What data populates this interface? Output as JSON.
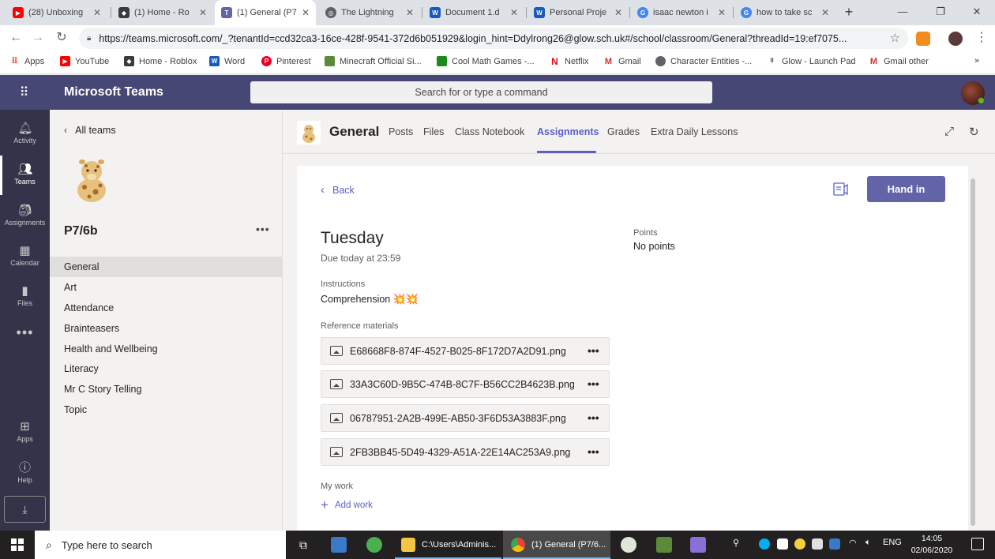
{
  "browser": {
    "tabs": [
      {
        "label": "(28) Unboxing",
        "icon": "youtube-icon",
        "color": "#ff0000"
      },
      {
        "label": "(1) Home - Ro",
        "icon": "roblox-icon",
        "color": "#393b3d"
      },
      {
        "label": "(1) General (P7",
        "icon": "teams-icon",
        "color": "#6264a7"
      },
      {
        "label": "The Lightning",
        "icon": "web-icon",
        "color": "#5f6368"
      },
      {
        "label": "Document 1.d",
        "icon": "word-icon",
        "color": "#185abd"
      },
      {
        "label": "Personal Proje",
        "icon": "word-icon",
        "color": "#185abd"
      },
      {
        "label": "isaac newton i",
        "icon": "google-icon",
        "color": "#4285f4"
      },
      {
        "label": "how to take sc",
        "icon": "google-icon",
        "color": "#4285f4"
      }
    ],
    "url": "https://teams.microsoft.com/_?tenantId=ccd32ca3-16ce-428f-9541-372d6b051929&login_hint=Ddylrong26@glow.sch.uk#/school/classroom/General?threadId=19:ef7075...",
    "bookmarks": [
      {
        "label": "Apps",
        "color": "#ea4335"
      },
      {
        "label": "YouTube",
        "color": "#ff0000"
      },
      {
        "label": "Home - Roblox",
        "color": "#393b3d"
      },
      {
        "label": "Word",
        "color": "#185abd"
      },
      {
        "label": "Pinterest",
        "color": "#e60023"
      },
      {
        "label": "Minecraft Official Si...",
        "color": "#5d8a3a"
      },
      {
        "label": "Cool Math Games -...",
        "color": "#1c8a1c"
      },
      {
        "label": "Netflix",
        "color": "#e50914"
      },
      {
        "label": "Gmail",
        "color": "#d93025"
      },
      {
        "label": "Character Entities -...",
        "color": "#5f6368"
      },
      {
        "label": "Glow - Launch Pad",
        "color": "#3c4043"
      },
      {
        "label": "Gmail other",
        "color": "#d93025"
      }
    ],
    "bookmarks_more": "»"
  },
  "teams": {
    "app_name": "Microsoft Teams",
    "search_placeholder": "Search for or type a command",
    "appbar": [
      {
        "label": "Activity",
        "icon": "bell-icon"
      },
      {
        "label": "Teams",
        "icon": "teams-icon"
      },
      {
        "label": "Assignments",
        "icon": "assignments-icon"
      },
      {
        "label": "Calendar",
        "icon": "calendar-icon"
      },
      {
        "label": "Files",
        "icon": "files-icon"
      },
      {
        "label": "Apps",
        "icon": "apps-icon"
      },
      {
        "label": "Help",
        "icon": "help-icon"
      }
    ],
    "more": "•••"
  },
  "team_panel": {
    "all_teams": "All teams",
    "team_name": "P7/6b",
    "team_more": "•••",
    "channels": [
      "General",
      "Art",
      "Attendance",
      "Brainteasers",
      "Health and Wellbeing",
      "Literacy",
      "Mr C Story Telling",
      "Topic"
    ]
  },
  "channel": {
    "name": "General",
    "tabs": [
      "Posts",
      "Files",
      "Class Notebook",
      "Assignments",
      "Grades",
      "Extra Daily Lessons"
    ]
  },
  "assignment": {
    "back": "Back",
    "hand_in": "Hand in",
    "title": "Tuesday",
    "due": "Due today at 23:59",
    "instructions_label": "Instructions",
    "instructions": "Comprehension",
    "instructions_emoji": "💥💥",
    "reference_label": "Reference materials",
    "files": [
      "E68668F8-874F-4527-B025-8F172D7A2D91.png",
      "33A3C60D-9B5C-474B-8C7F-B56CC2B4623B.png",
      "06787951-2A2B-499E-AB50-3F6D53A3883F.png",
      "2FB3BB45-5D49-4329-A51A-22E14AC253A9.png"
    ],
    "file_more": "•••",
    "points_label": "Points",
    "points_value": "No points",
    "my_work_label": "My work",
    "add_work": "Add work"
  },
  "taskbar": {
    "search_placeholder": "Type here to search",
    "explorer_label": "C:\\Users\\Adminis...",
    "chrome_label": "(1) General (P7/6...",
    "language": "ENG",
    "time": "14:05",
    "date": "02/06/2020"
  }
}
